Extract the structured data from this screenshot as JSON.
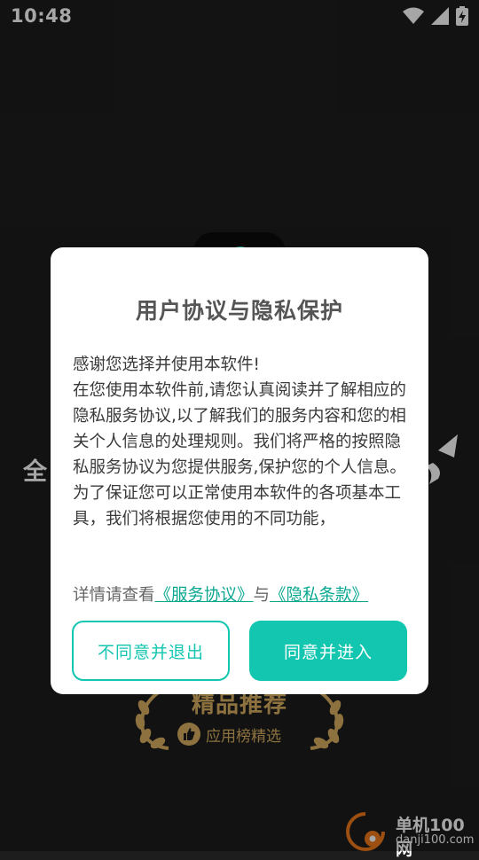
{
  "status_bar": {
    "time": "10:48",
    "icons": [
      "wifi-icon",
      "cellular-signal-icon",
      "battery-charging-icon"
    ]
  },
  "splash": {
    "slogan_visible": "全",
    "award_title": "精品推荐",
    "award_subtitle": "应用榜精选",
    "icons": [
      "thumbs-up-icon",
      "laurel-left-icon",
      "laurel-right-icon"
    ]
  },
  "watermark": {
    "title": "单机100网",
    "subtitle": "danji100.com"
  },
  "dialog": {
    "title": "用户协议与隐私保护",
    "paragraphs": [
      "感谢您选择并使用本软件!",
      "在您使用本软件前,请您认真阅读并了解相应的隐私服务协议,以了解我们的服务内容和您的相关个人信息的处理规则。我们将严格的按照隐私服务协议为您提供服务,保护您的个人信息。",
      "为了保证您可以正常使用本软件的各项基本工具，我们将根据您使用的不同功能，"
    ],
    "links_prefix": "详情请查看",
    "service_link": "《服务协议》",
    "links_joiner": "与",
    "privacy_link": "《隐私条款》",
    "decline_label": "不同意并退出",
    "agree_label": "同意并进入"
  },
  "colors": {
    "accent": "#12c6b0",
    "link": "#0aa891",
    "gold": "#d9b062",
    "background": "#1d1d1d"
  }
}
